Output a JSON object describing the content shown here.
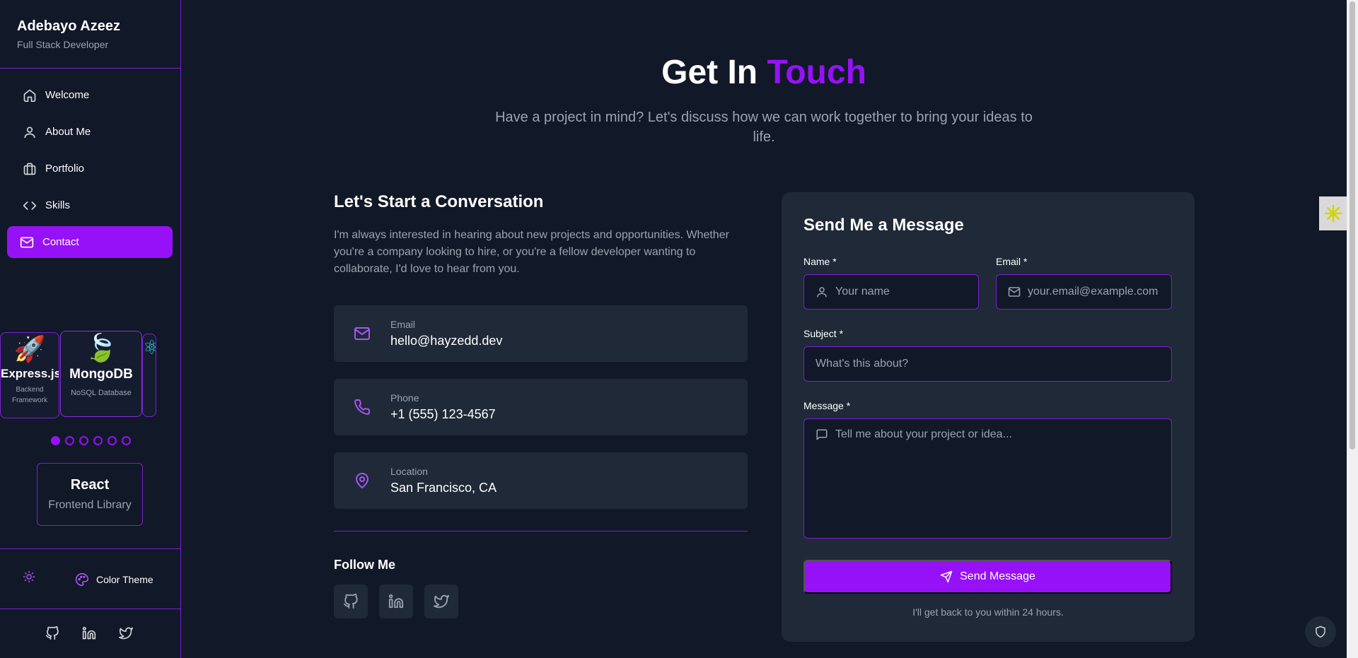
{
  "sidebar": {
    "brand_name": "Adebayo Azeez",
    "brand_role": "Full Stack Developer",
    "items": [
      {
        "label": "Welcome",
        "icon": "home-icon"
      },
      {
        "label": "About Me",
        "icon": "user-icon"
      },
      {
        "label": "Portfolio",
        "icon": "briefcase-icon"
      },
      {
        "label": "Skills",
        "icon": "code-icon"
      },
      {
        "label": "Contact",
        "icon": "mail-icon",
        "active": true
      }
    ],
    "carousel": [
      {
        "title": "Express.js",
        "subtitle": "Backend Framework",
        "emoji": "🚀"
      },
      {
        "title": "MongoDB",
        "subtitle": "NoSQL Database",
        "emoji": "🍃"
      },
      {
        "title": "",
        "subtitle": "",
        "emoji": "⚛"
      }
    ],
    "dots_total": 6,
    "dots_active": 1,
    "featured_skill": {
      "title": "React",
      "subtitle": "Frontend Library"
    },
    "color_theme_label": "Color Theme"
  },
  "header": {
    "title_part1": "Get In",
    "title_part2": "Touch",
    "subtitle": "Have a project in mind? Let's discuss how we can work together to bring your ideas to life."
  },
  "conversation": {
    "title": "Let's Start a Conversation",
    "text": "I'm always interested in hearing about new projects and opportunities. Whether you're a company looking to hire, or you're a fellow developer wanting to collaborate, I'd love to hear from you.",
    "contacts": [
      {
        "label": "Email",
        "value": "hello@hayzedd.dev",
        "icon": "mail-icon"
      },
      {
        "label": "Phone",
        "value": "+1 (555) 123-4567",
        "icon": "phone-icon"
      },
      {
        "label": "Location",
        "value": "San Francisco, CA",
        "icon": "map-pin-icon"
      }
    ],
    "follow_title": "Follow Me"
  },
  "form": {
    "title": "Send Me a Message",
    "name_label": "Name *",
    "name_placeholder": "Your name",
    "email_label": "Email *",
    "email_placeholder": "your.email@example.com",
    "subject_label": "Subject *",
    "subject_placeholder": "What's this about?",
    "message_label": "Message *",
    "message_placeholder": "Tell me about your project or idea...",
    "send_label": "Send Message",
    "note": "I'll get back to you within 24 hours."
  },
  "colors": {
    "accent": "#9711f7",
    "background": "#111827",
    "panel": "#1f2937"
  }
}
